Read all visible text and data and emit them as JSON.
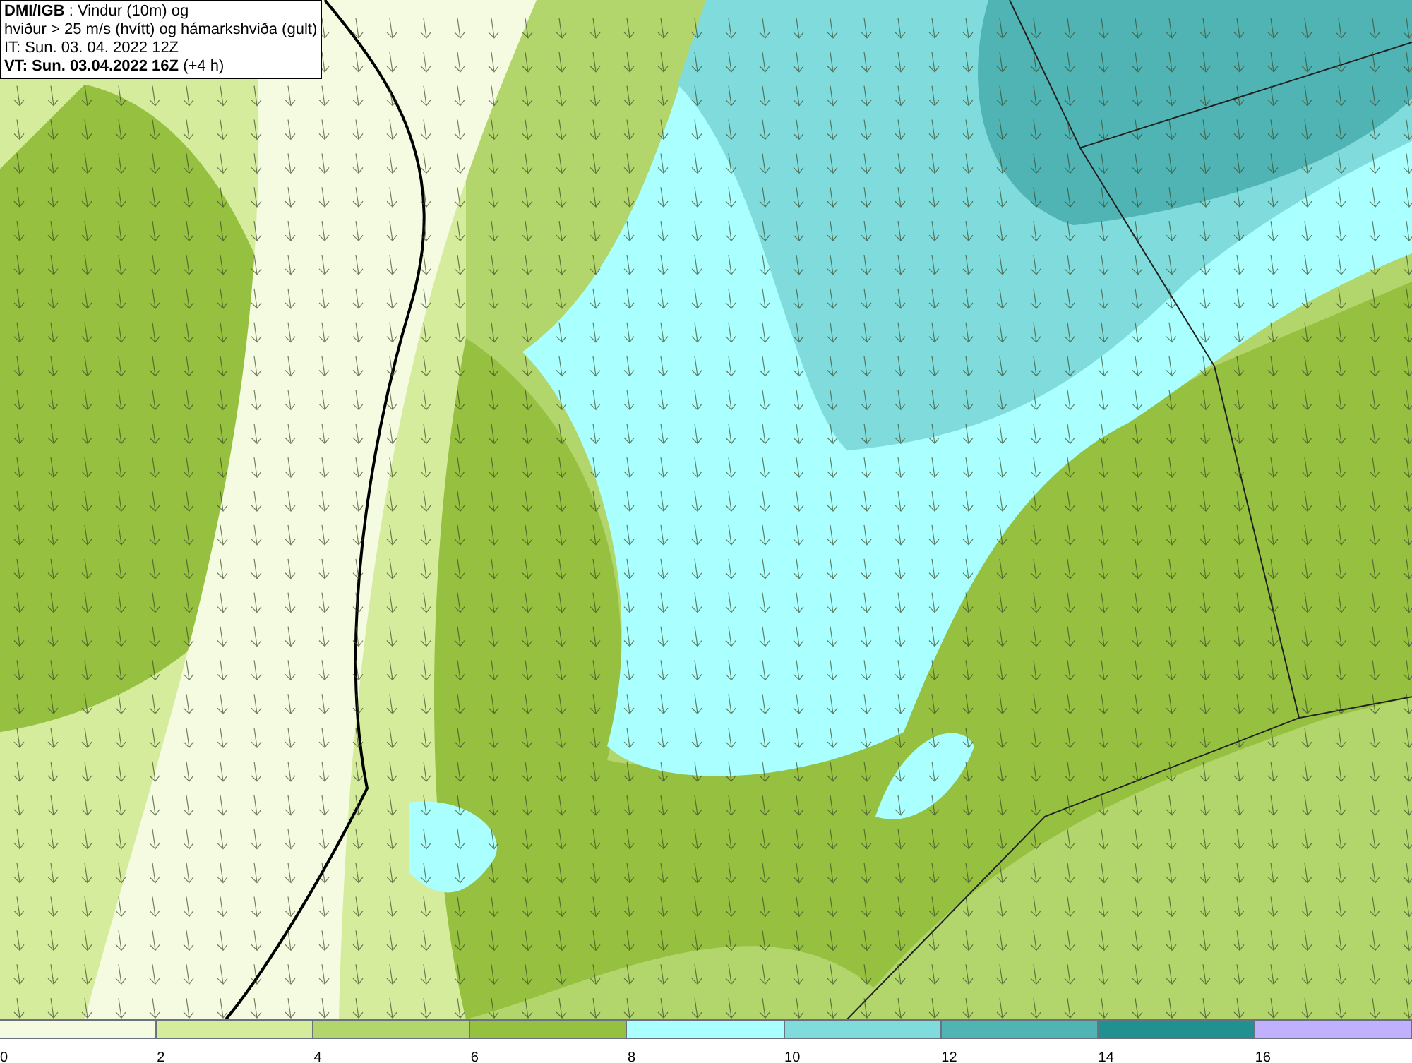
{
  "header": {
    "lines": [
      "**DMI/IGB** : Vindur (10m) og",
      "hviður > 25 m/s (hvítt) og hámarkshviða (gult)",
      "IT: Sun. 03. 04. 2022 12Z",
      "**VT: Sun. 03.04.2022 16Z** (+4 h)"
    ]
  },
  "legend": [
    {
      "label": "0",
      "color": "#f5fbe0"
    },
    {
      "label": "2",
      "color": "#d4ec9c"
    },
    {
      "label": "4",
      "color": "#b3d66c"
    },
    {
      "label": "6",
      "color": "#96c040"
    },
    {
      "label": "8",
      "color": "#aaffff"
    },
    {
      "label": "10",
      "color": "#80dcdc"
    },
    {
      "label": "12",
      "color": "#50b4b4"
    },
    {
      "label": "14",
      "color": "#209090"
    },
    {
      "label": "16",
      "color": "#c0b0ff"
    }
  ]
}
